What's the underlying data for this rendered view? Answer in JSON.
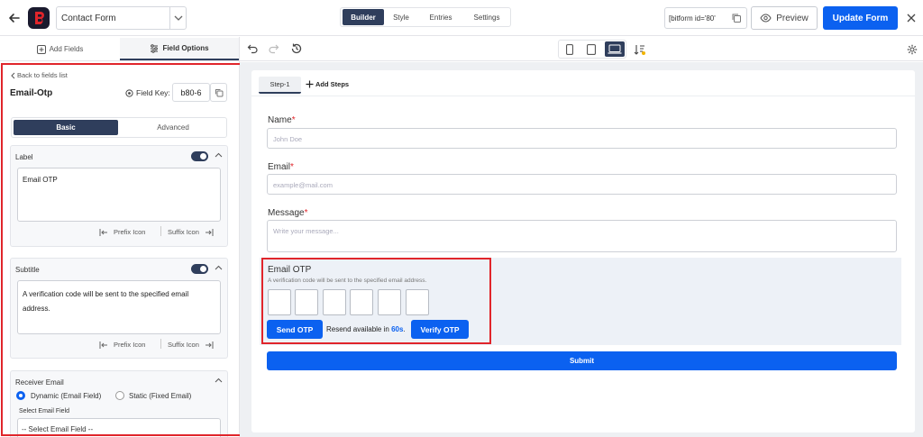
{
  "header": {
    "form_name": "Contact Form",
    "tabs": [
      "Builder",
      "Style",
      "Entries",
      "Settings"
    ],
    "shortcode": "[bitform id='80'",
    "preview_label": "Preview",
    "update_label": "Update Form"
  },
  "sidebar": {
    "tab_add_fields": "Add Fields",
    "tab_field_options": "Field Options",
    "back_label": "Back to fields list",
    "field_title": "Email-Otp",
    "field_key_label": "Field Key:",
    "field_key_value": "b80-6",
    "mode_tabs": [
      "Basic",
      "Advanced"
    ],
    "label_section": {
      "title": "Label",
      "value": "Email OTP",
      "prefix_icon": "Prefix Icon",
      "suffix_icon": "Suffix Icon"
    },
    "subtitle_section": {
      "title": "Subtitle",
      "value": "A verification code will be sent to the specified email address.",
      "prefix_icon": "Prefix Icon",
      "suffix_icon": "Suffix Icon"
    },
    "receiver_section": {
      "title": "Receiver Email",
      "option_dynamic": "Dynamic (Email Field)",
      "option_static": "Static (Fixed Email)",
      "select_label": "Select Email Field",
      "select_value": "-- Select Email Field --"
    }
  },
  "canvas": {
    "step_label": "Step-1",
    "add_steps_label": "Add Steps",
    "name": {
      "label": "Name",
      "required": "*",
      "placeholder": "John Doe"
    },
    "email": {
      "label": "Email",
      "required": "*",
      "placeholder": "example@mail.com"
    },
    "message": {
      "label": "Message",
      "required": "*",
      "placeholder": "Write your message..."
    },
    "otp": {
      "label": "Email OTP",
      "subtitle": "A verification code will be sent to the specified email address.",
      "send_label": "Send OTP",
      "resend_text": "Resend available in",
      "resend_seconds": "60s",
      "resend_suffix": ".",
      "verify_label": "Verify OTP"
    },
    "submit_label": "Submit"
  },
  "colors": {
    "accent": "#0b61f0",
    "dark_nav": "#2f3e5c",
    "highlight": "#e0252b",
    "required": "#e0252b"
  }
}
